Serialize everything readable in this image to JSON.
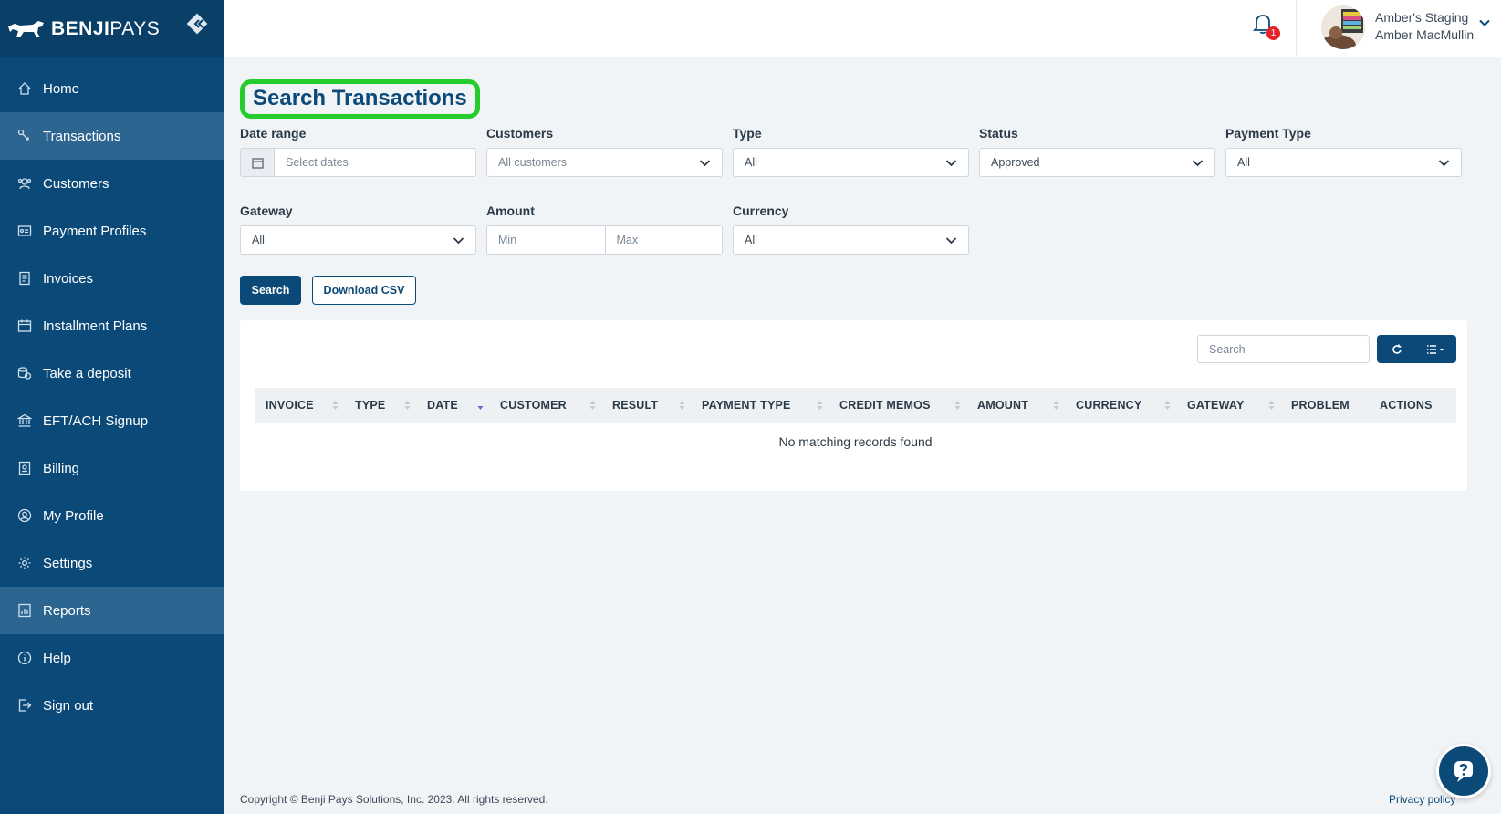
{
  "brand": {
    "name_bold": "BENJI",
    "name_light": "PAYS"
  },
  "sidebar": {
    "items": [
      {
        "label": "Home",
        "icon": "home-icon",
        "active": false
      },
      {
        "label": "Transactions",
        "icon": "transactions-icon",
        "active": true
      },
      {
        "label": "Customers",
        "icon": "customers-icon",
        "active": false
      },
      {
        "label": "Payment Profiles",
        "icon": "payment-profiles-icon",
        "active": false
      },
      {
        "label": "Invoices",
        "icon": "invoices-icon",
        "active": false
      },
      {
        "label": "Installment Plans",
        "icon": "calendar-icon",
        "active": false
      },
      {
        "label": "Take a deposit",
        "icon": "deposit-icon",
        "active": false
      },
      {
        "label": "EFT/ACH Signup",
        "icon": "bank-icon",
        "active": false
      },
      {
        "label": "Billing",
        "icon": "billing-icon",
        "active": false
      },
      {
        "label": "My Profile",
        "icon": "profile-icon",
        "active": false
      },
      {
        "label": "Settings",
        "icon": "gear-icon",
        "active": false
      },
      {
        "label": "Reports",
        "icon": "reports-icon",
        "active": true
      },
      {
        "label": "Help",
        "icon": "help-icon",
        "active": false
      },
      {
        "label": "Sign out",
        "icon": "sign-out-icon",
        "active": false
      }
    ]
  },
  "header": {
    "notification_count": "1",
    "account_name": "Amber's Staging",
    "user_name": "Amber MacMullin"
  },
  "page": {
    "title": "Search Transactions"
  },
  "filters": {
    "date_range": {
      "label": "Date range",
      "placeholder": "Select dates"
    },
    "customers": {
      "label": "Customers",
      "value": "All customers"
    },
    "type": {
      "label": "Type",
      "value": "All"
    },
    "status": {
      "label": "Status",
      "value": "Approved"
    },
    "payment_type": {
      "label": "Payment Type",
      "value": "All"
    },
    "gateway": {
      "label": "Gateway",
      "value": "All"
    },
    "amount": {
      "label": "Amount",
      "min_placeholder": "Min",
      "max_placeholder": "Max"
    },
    "currency": {
      "label": "Currency",
      "value": "All"
    }
  },
  "actions": {
    "search_label": "Search",
    "download_label": "Download CSV"
  },
  "table": {
    "search_placeholder": "Search",
    "columns": [
      "INVOICE",
      "TYPE",
      "DATE",
      "CUSTOMER",
      "RESULT",
      "PAYMENT TYPE",
      "CREDIT MEMOS",
      "AMOUNT",
      "CURRENCY",
      "GATEWAY",
      "PROBLEM",
      "ACTIONS"
    ],
    "empty_message": "No matching records found"
  },
  "footer": {
    "copyright": "Copyright © Benji Pays Solutions, Inc. 2023. All rights reserved.",
    "privacy": "Privacy policy"
  },
  "colors": {
    "primary": "#0b4a78",
    "sidebar": "#0b4a78",
    "highlight": "#25cc2e",
    "badge": "#e8202a"
  }
}
